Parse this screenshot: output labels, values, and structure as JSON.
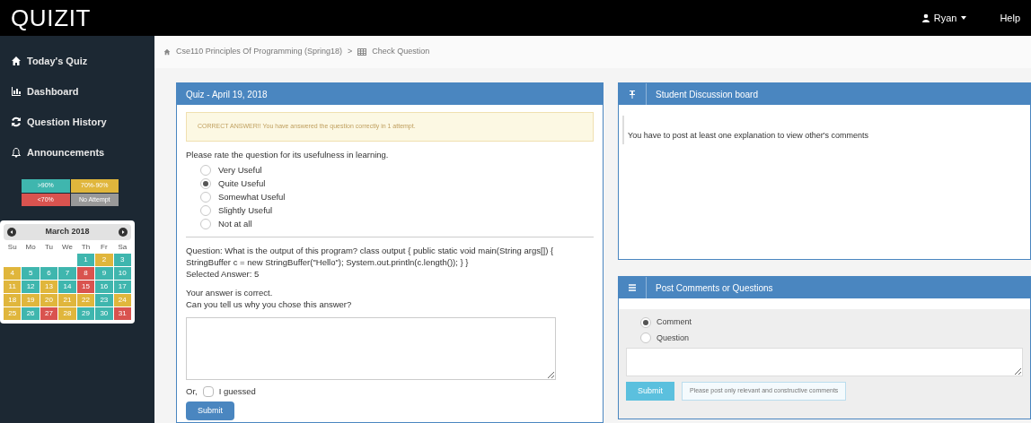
{
  "topbar": {
    "logo": "QUIZIT",
    "user": "Ryan",
    "help": "Help"
  },
  "sidebar": {
    "items": [
      {
        "label": "Today's Quiz",
        "selected": false
      },
      {
        "label": "Dashboard",
        "selected": false
      },
      {
        "label": "Question History",
        "selected": false
      },
      {
        "label": "Announcements",
        "selected": false
      }
    ],
    "legend": [
      {
        "label": ">90%",
        "color": "#3fb6ae"
      },
      {
        "label": "70%-90%",
        "color": "#e0b63c"
      },
      {
        "label": "<70%",
        "color": "#d9534f"
      },
      {
        "label": "No Attempt",
        "color": "#999999"
      }
    ],
    "calendar": {
      "title": "March 2018",
      "weekdays": [
        "Su",
        "Mo",
        "Tu",
        "We",
        "Th",
        "Fr",
        "Sa"
      ],
      "days": [
        {
          "label": "1",
          "color": "#3fb6ae"
        },
        {
          "label": "2",
          "color": "#e0b63c"
        },
        {
          "label": "3",
          "color": "#3fb6ae"
        },
        {
          "label": "4",
          "color": "#e0b63c"
        },
        {
          "label": "5",
          "color": "#3fb6ae"
        },
        {
          "label": "6",
          "color": "#3fb6ae"
        },
        {
          "label": "7",
          "color": "#3fb6ae"
        },
        {
          "label": "8",
          "color": "#d9534f"
        },
        {
          "label": "9",
          "color": "#3fb6ae"
        },
        {
          "label": "10",
          "color": "#3fb6ae"
        },
        {
          "label": "11",
          "color": "#e0b63c"
        },
        {
          "label": "12",
          "color": "#3fb6ae"
        },
        {
          "label": "13",
          "color": "#e0b63c"
        },
        {
          "label": "14",
          "color": "#3fb6ae"
        },
        {
          "label": "15",
          "color": "#d9534f"
        },
        {
          "label": "16",
          "color": "#3fb6ae"
        },
        {
          "label": "17",
          "color": "#3fb6ae"
        },
        {
          "label": "18",
          "color": "#e0b63c"
        },
        {
          "label": "19",
          "color": "#e0b63c"
        },
        {
          "label": "20",
          "color": "#e0b63c"
        },
        {
          "label": "21",
          "color": "#e0b63c"
        },
        {
          "label": "22",
          "color": "#e0b63c"
        },
        {
          "label": "23",
          "color": "#3fb6ae"
        },
        {
          "label": "24",
          "color": "#e0b63c"
        },
        {
          "label": "25",
          "color": "#e0b63c"
        },
        {
          "label": "26",
          "color": "#3fb6ae"
        },
        {
          "label": "27",
          "color": "#d9534f"
        },
        {
          "label": "28",
          "color": "#e0b63c"
        },
        {
          "label": "29",
          "color": "#3fb6ae"
        },
        {
          "label": "30",
          "color": "#3fb6ae"
        },
        {
          "label": "31",
          "color": "#d9534f"
        }
      ]
    }
  },
  "breadcrumb": {
    "course": "Cse110 Principles Of Programming (Spring18)",
    "separator": ">",
    "page": "Check Question"
  },
  "quiz": {
    "title": "Quiz - April 19, 2018",
    "alert": "CORRECT ANSWER!! You have answered the question correctly in 1 attempt.",
    "rating_prompt": "Please rate the question for its usefulness in learning.",
    "ratings": [
      {
        "label": "Very Useful",
        "selected": false
      },
      {
        "label": "Quite Useful",
        "selected": true
      },
      {
        "label": "Somewhat Useful",
        "selected": false
      },
      {
        "label": "Slightly Useful",
        "selected": false
      },
      {
        "label": "Not at all",
        "selected": false
      }
    ],
    "question": "Question: What is the output of this program? class output { public static void main(String args[]) { StringBuffer c = new StringBuffer(\"Hello\"); System.out.println(c.length()); } }",
    "selected_answer": "Selected Answer: 5",
    "feedback": "Your answer is correct.",
    "why_prompt": "Can you tell us why you chose this answer?",
    "or_label": "Or,",
    "guessed": {
      "label": "I guessed",
      "checked": false
    },
    "submit": "Submit"
  },
  "discussion": {
    "title": "Student Discussion board",
    "message": "You have to post at least one explanation to view other's comments"
  },
  "post": {
    "title": "Post Comments or Questions",
    "types": [
      {
        "label": "Comment",
        "selected": true
      },
      {
        "label": "Question",
        "selected": false
      }
    ],
    "submit": "Submit",
    "notice": "Please post only relevant and constructive comments"
  }
}
